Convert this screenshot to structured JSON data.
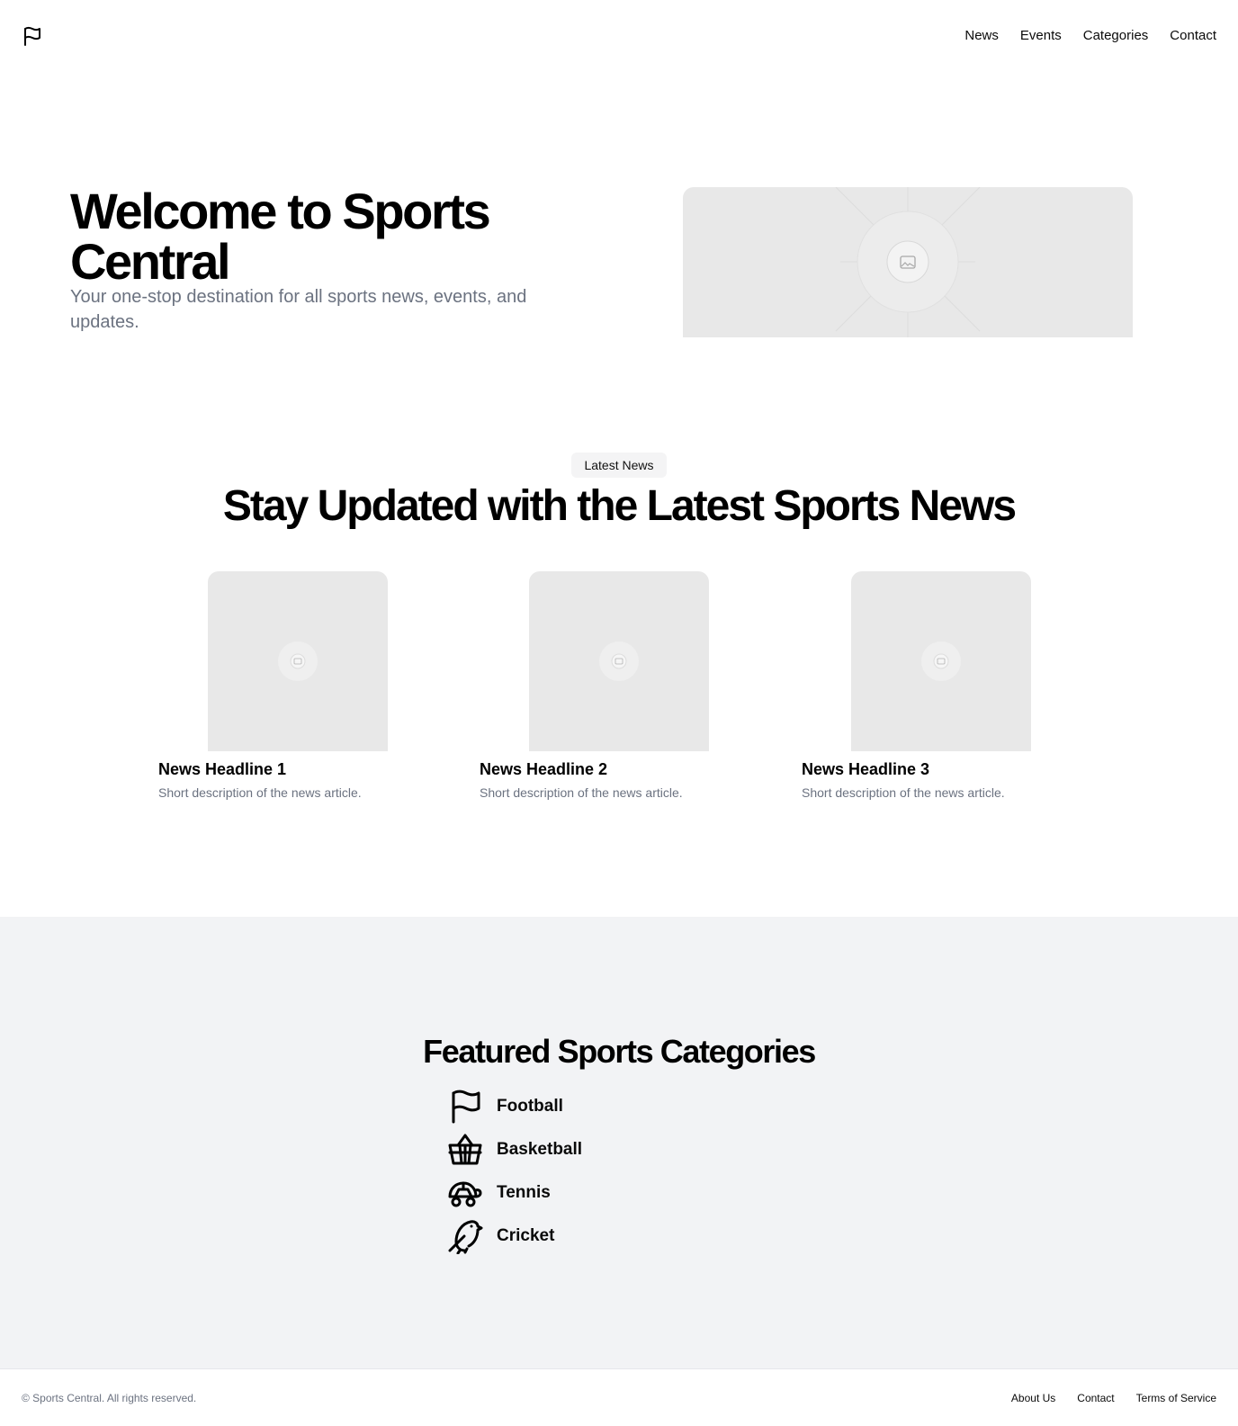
{
  "header": {
    "logo_icon": "flag-icon",
    "nav": [
      "News",
      "Events",
      "Categories",
      "Contact"
    ]
  },
  "hero": {
    "title": "Welcome to Sports Central",
    "subtitle": "Your one-stop destination for all sports news, events, and updates.",
    "image_icon": "image-placeholder-icon"
  },
  "news": {
    "badge": "Latest News",
    "title": "Stay Updated with the Latest Sports News",
    "items": [
      {
        "headline": "News Headline 1",
        "description": "Short description of the news article."
      },
      {
        "headline": "News Headline 2",
        "description": "Short description of the news article."
      },
      {
        "headline": "News Headline 3",
        "description": "Short description of the news article."
      }
    ]
  },
  "categories": {
    "title": "Featured Sports Categories",
    "items": [
      {
        "label": "Football",
        "icon": "flag-icon"
      },
      {
        "label": "Basketball",
        "icon": "basket-icon"
      },
      {
        "label": "Tennis",
        "icon": "turtle-icon"
      },
      {
        "label": "Cricket",
        "icon": "bird-icon"
      }
    ]
  },
  "footer": {
    "copyright": "© Sports Central. All rights reserved.",
    "links": [
      "About Us",
      "Contact",
      "Terms of Service"
    ]
  },
  "colors": {
    "text": "#0a0a0a",
    "muted": "#6b7280",
    "placeholder": "#e8e8e8",
    "section_bg": "#f2f3f5",
    "badge_bg": "#f4f4f5"
  }
}
